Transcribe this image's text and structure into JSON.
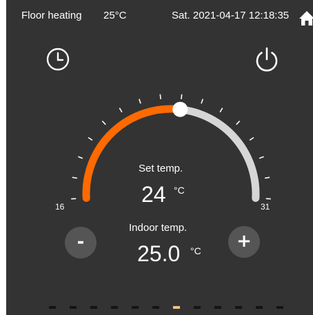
{
  "status_bar": {
    "mode": "Floor heating",
    "current_temp": "25°C",
    "datetime": "Sat. 2021-04-17 12:18:35",
    "home_icon": "home-icon"
  },
  "controls": {
    "timer_icon": "clock-icon",
    "power_icon": "power-icon",
    "minus_label": "-",
    "plus_label": "+"
  },
  "dial": {
    "min": 16,
    "max": 31,
    "min_label": "16",
    "max_label": "31",
    "value": 24,
    "active_color": "#ff6a00",
    "inactive_color": "#d6d6d6"
  },
  "set_temp": {
    "label": "Set temp.",
    "value": "24",
    "unit": "°C"
  },
  "indoor_temp": {
    "label": "Indoor temp.",
    "value": "25.0",
    "unit": "°C"
  },
  "pager": {
    "count": 12,
    "active_index": 6
  }
}
